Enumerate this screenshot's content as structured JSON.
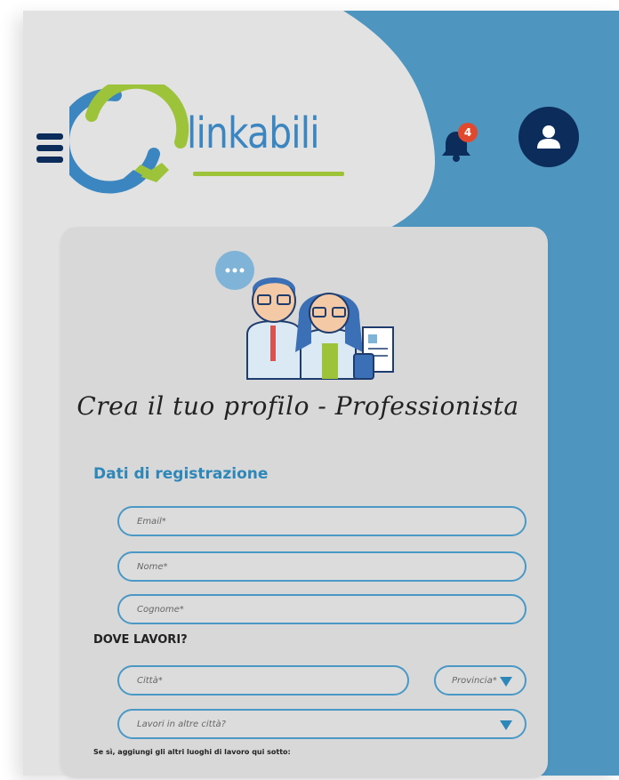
{
  "header": {
    "logo_text": "linkabili",
    "notification_count": "4",
    "icons": {
      "menu": "hamburger-menu-icon",
      "bell": "bell-icon",
      "user": "user-icon"
    },
    "colors": {
      "navy": "#0c2d5c",
      "blue": "#3b86c1",
      "green": "#9dc33b",
      "accent": "#4e95bf",
      "badge": "#e0492d"
    }
  },
  "form": {
    "title": "Crea il tuo profilo - Professionista",
    "section_registration": "Dati di registrazione",
    "email_placeholder": "Email*",
    "name_placeholder": "Nome*",
    "surname_placeholder": "Cognome*",
    "work_question": "DOVE LAVORI?",
    "city_placeholder": "Città*",
    "province_placeholder": "Provincia*",
    "other_cities_placeholder": "Lavori in altre città?",
    "other_places_note": "Se sì, aggiungi gli altri luoghi di lavoro qui sotto:"
  }
}
